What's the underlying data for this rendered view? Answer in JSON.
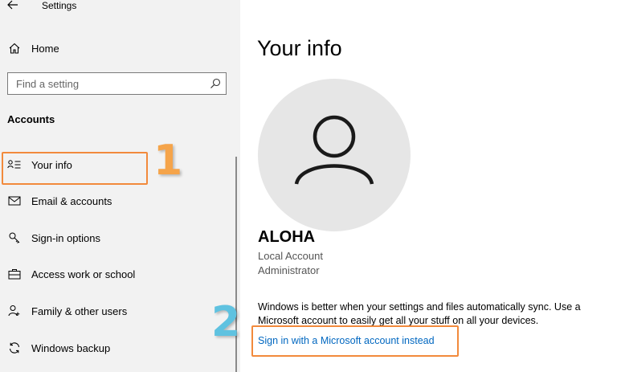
{
  "window": {
    "title": "Settings"
  },
  "sidebar": {
    "home_label": "Home",
    "search": {
      "placeholder": "Find a setting"
    },
    "section_heading": "Accounts",
    "items": [
      {
        "label": "Your info",
        "icon": "person-card-icon"
      },
      {
        "label": "Email & accounts",
        "icon": "mail-icon"
      },
      {
        "label": "Sign-in options",
        "icon": "key-icon"
      },
      {
        "label": "Access work or school",
        "icon": "briefcase-icon"
      },
      {
        "label": "Family & other users",
        "icon": "add-person-icon"
      },
      {
        "label": "Windows backup",
        "icon": "sync-icon"
      }
    ]
  },
  "main": {
    "page_title": "Your info",
    "user": {
      "name": "ALOHA",
      "account_type": "Local Account",
      "role": "Administrator"
    },
    "sync_text": "Windows is better when your settings and files automatically sync. Use a Microsoft account to easily get all your stuff on all your devices.",
    "ms_link": "Sign in with a Microsoft account instead"
  },
  "annotations": {
    "step1": "1",
    "step2": "2",
    "highlight_color": "#f28a3c",
    "step1_color": "#f5a44a",
    "step2_color": "#5fc2e0"
  },
  "colors": {
    "link": "#0067c0",
    "sidebar_bg": "#f2f2f2",
    "avatar_bg": "#e6e6e6"
  }
}
